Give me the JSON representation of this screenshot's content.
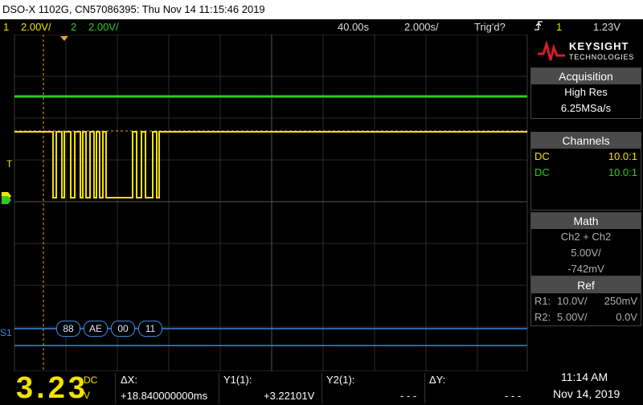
{
  "window": {
    "title": "DSO-X 1102G, CN57086395: Thu Nov 14 11:15:46 2019"
  },
  "status": {
    "ch1_num": "1",
    "ch1_scale": "2.00V/",
    "ch2_num": "2",
    "ch2_scale": "2.00V/",
    "horizontal_pos": "40.00s",
    "time_scale": "2.000s/",
    "trigger_state": "Trig'd?",
    "trigger_source": "1",
    "trigger_level": "1.23V",
    "trigger_icon": "trigger-edge-icon"
  },
  "brand": {
    "name": "KEYSIGHT",
    "sub": "TECHNOLOGIES",
    "color": "#d41b2c"
  },
  "acquisition": {
    "header": "Acquisition",
    "mode": "High Res",
    "rate": "6.25MSa/s"
  },
  "channels": {
    "header": "Channels",
    "rows": [
      {
        "coupling": "DC",
        "probe": "10.0:1",
        "color": "#f2e200"
      },
      {
        "coupling": "DC",
        "probe": "10.0:1",
        "color": "#2ecc1e"
      }
    ]
  },
  "math": {
    "header": "Math",
    "operation": "Ch2 + Ch2",
    "scale": "5.00V/",
    "offset": "-742mV"
  },
  "ref": {
    "header": "Ref",
    "rows": [
      {
        "name": "R1:",
        "scale": "10.0V/",
        "offset": "250mV"
      },
      {
        "name": "R2:",
        "scale": "5.00V/",
        "offset": "0.0V"
      }
    ]
  },
  "serial_decode": {
    "label": "S1",
    "bytes": [
      "88",
      "AE",
      "00",
      "11"
    ]
  },
  "markers": {
    "trigger_label": "T",
    "ch_marker": "1"
  },
  "measurements": {
    "meter_value": "3.23",
    "meter_coupling": "DC",
    "meter_unit": "V",
    "delta_x_label": "ΔX:",
    "delta_x_value": "+18.840000000ms",
    "y1_label": "Y1(1):",
    "y1_value": "+3.22101V",
    "y2_label": "Y2(1):",
    "y2_value": "- - -",
    "delta_y_label": "ΔY:",
    "delta_y_value": "- - -",
    "time": "11:14 AM",
    "date": "Nov 14, 2019"
  },
  "colors": {
    "ch1": "#f2e200",
    "ch2": "#2ecc1e",
    "decode": "#3f86e0",
    "cursor": "#f0a030"
  }
}
